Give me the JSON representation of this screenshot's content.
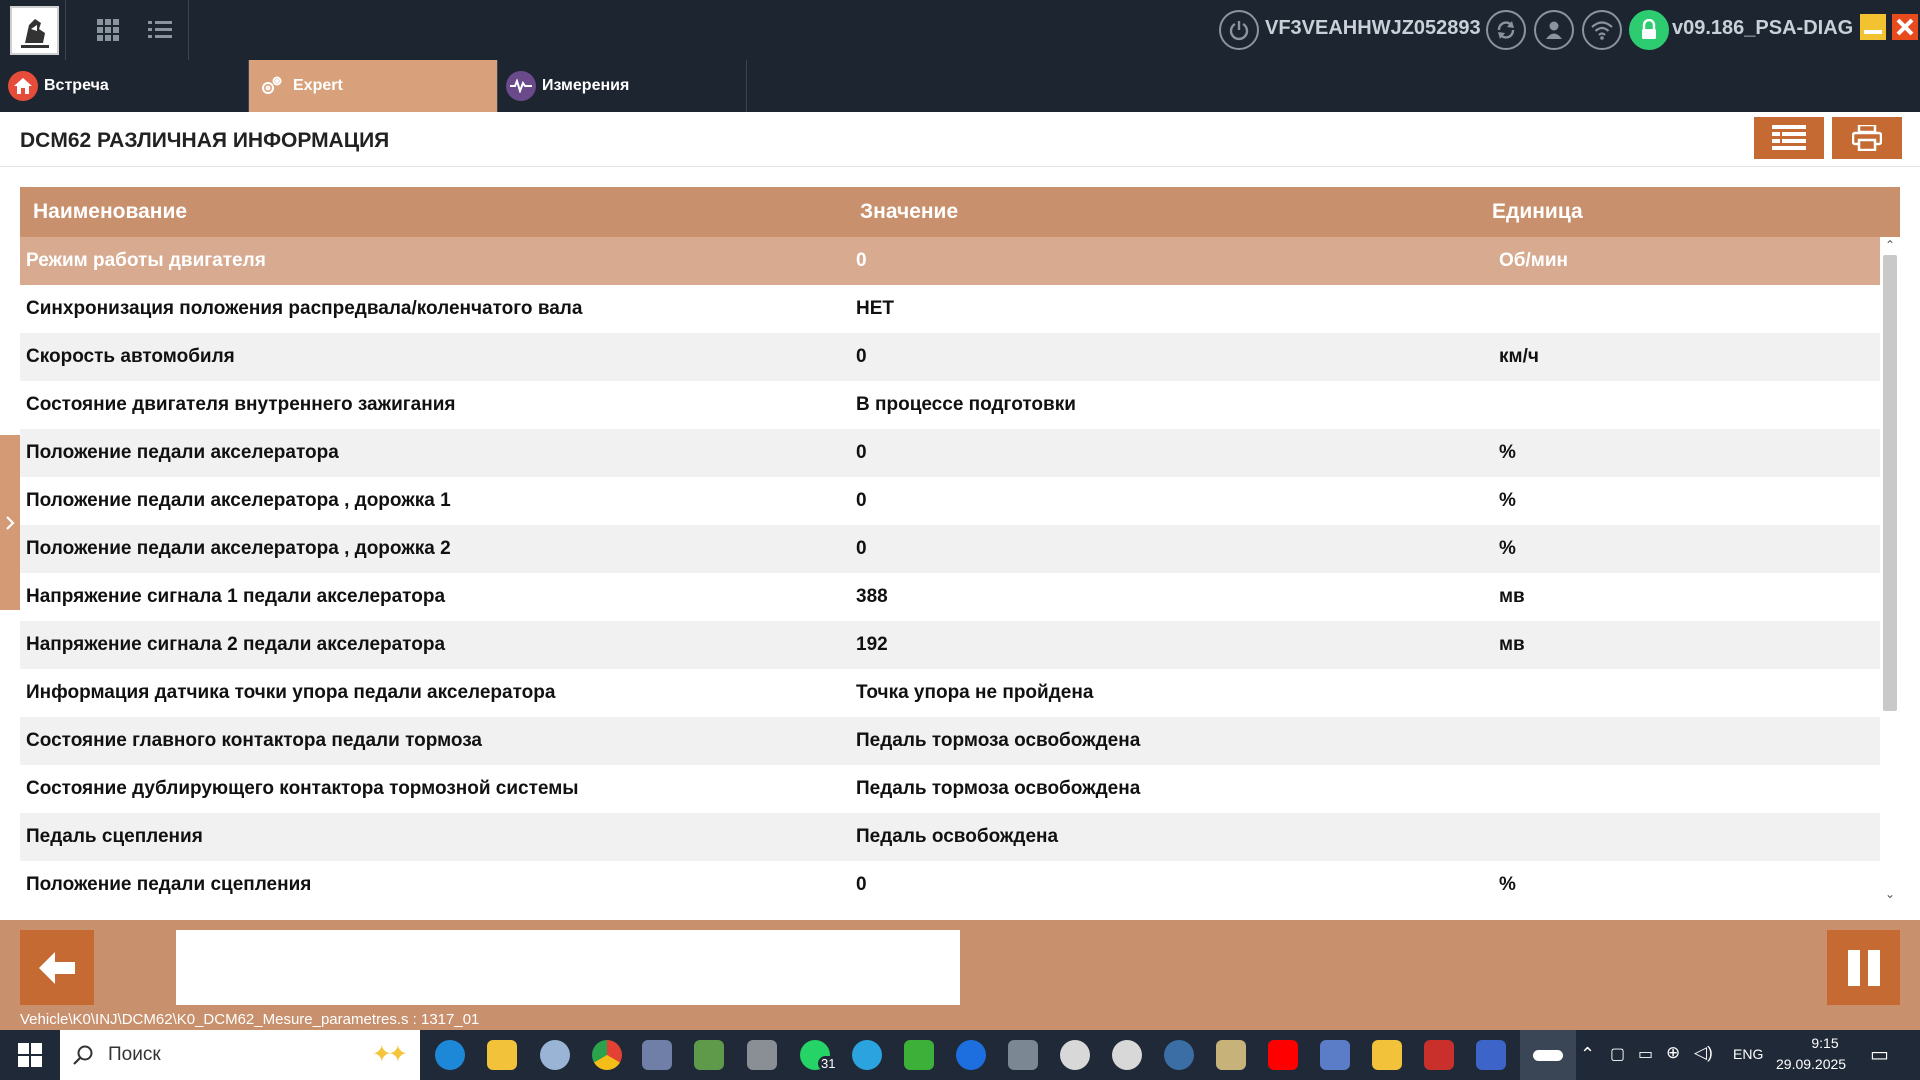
{
  "topbar": {
    "vin": "VF3VEAHHWJZ052893",
    "version": "v09.186_PSA-DIAG"
  },
  "tabs": [
    {
      "label": "Встреча",
      "icon": "home-icon",
      "active": false
    },
    {
      "label": "Expert",
      "icon": "gears-icon",
      "active": true
    },
    {
      "label": "Измерения",
      "icon": "pulse-icon",
      "active": false
    }
  ],
  "page": {
    "title": "DCM62 РАЗЛИЧНАЯ ИНФОРМАЦИЯ"
  },
  "table": {
    "headers": {
      "name": "Наименование",
      "value": "Значение",
      "unit": "Единица"
    },
    "rows": [
      {
        "name": "Режим работы двигателя",
        "value": "0",
        "unit": "Об/мин"
      },
      {
        "name": "Синхронизация положения распредвала/коленчатого вала",
        "value": "НЕТ",
        "unit": ""
      },
      {
        "name": "Скорость автомобиля",
        "value": "0",
        "unit": "км/ч"
      },
      {
        "name": "Состояние двигателя внутреннего зажигания",
        "value": "В процессе подготовки",
        "unit": ""
      },
      {
        "name": "Положение педали акселератора",
        "value": "0",
        "unit": "%"
      },
      {
        "name": "Положение педали акселератора , дорожка 1",
        "value": "0",
        "unit": "%"
      },
      {
        "name": "Положение педали акселератора , дорожка 2",
        "value": "0",
        "unit": "%"
      },
      {
        "name": "Напряжение сигнала 1 педали акселератора",
        "value": "388",
        "unit": "мв"
      },
      {
        "name": "Напряжение сигнала 2 педали акселератора",
        "value": "192",
        "unit": "мв"
      },
      {
        "name": "Информация датчика точки упора педали акселератора",
        "value": "Точка упора не пройдена",
        "unit": ""
      },
      {
        "name": "Состояние главного контактора педали тормоза",
        "value": "Педаль тормоза освобождена",
        "unit": ""
      },
      {
        "name": "Состояние дублирующего контактора тормозной системы",
        "value": "Педаль тормоза освобождена",
        "unit": ""
      },
      {
        "name": "Педаль сцепления",
        "value": "Педаль освобождена",
        "unit": ""
      },
      {
        "name": "Положение педали сцепления",
        "value": "0",
        "unit": "%"
      }
    ]
  },
  "footer": {
    "path": "Vehicle\\K0\\INJ\\DCM62\\K0_DCM62_Mesure_parametres.s : 1317_01"
  },
  "taskbar": {
    "search_placeholder": "Поиск",
    "whatsapp_badge": "31",
    "language": "ENG",
    "time": "9:15",
    "date": "29.09.2025"
  },
  "colors": {
    "topbar_bg": "#1c2530",
    "accent": "#c8906c",
    "accent_dark": "#c46a32",
    "row_selected": "#d8ab90",
    "tab_active": "#d8a17b"
  }
}
